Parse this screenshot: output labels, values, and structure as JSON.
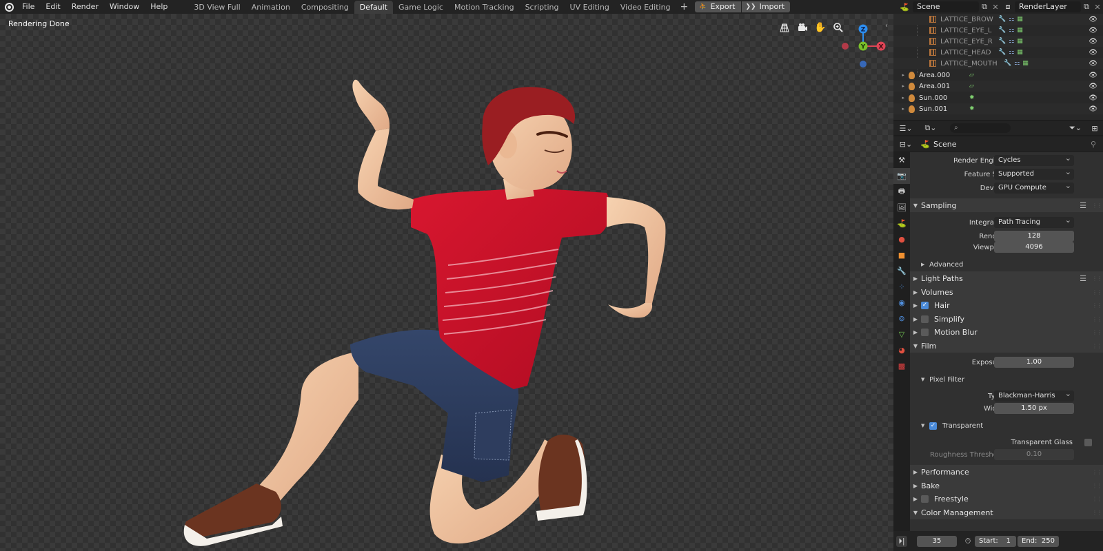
{
  "menu": [
    "File",
    "Edit",
    "Render",
    "Window",
    "Help"
  ],
  "workspaces": [
    "3D View Full",
    "Animation",
    "Compositing",
    "Default",
    "Game Logic",
    "Motion Tracking",
    "Scripting",
    "UV Editing",
    "Video Editing"
  ],
  "active_workspace": "Default",
  "add_workspace": "+",
  "io": {
    "export": "Export",
    "import": "Import"
  },
  "scene": {
    "scene_name": "Scene",
    "render_layer": "RenderLayer"
  },
  "viewport": {
    "status": "Rendering Done"
  },
  "gizmo": {
    "z": "Z",
    "y": "Y",
    "x": "X"
  },
  "outliner": {
    "items": [
      {
        "name": "LATTICE_BROW",
        "type": "lattice"
      },
      {
        "name": "LATTICE_EYE_L",
        "type": "lattice"
      },
      {
        "name": "LATTICE_EYE_R",
        "type": "lattice"
      },
      {
        "name": "LATTICE_HEAD",
        "type": "lattice"
      },
      {
        "name": "LATTICE_MOUTH",
        "type": "lattice"
      },
      {
        "name": "Area.000",
        "type": "light"
      },
      {
        "name": "Area.001",
        "type": "light"
      },
      {
        "name": "Sun.000",
        "type": "light"
      },
      {
        "name": "Sun.001",
        "type": "light"
      }
    ]
  },
  "properties": {
    "context": "Scene",
    "search_placeholder": "",
    "render_engine": {
      "label": "Render Engine",
      "value": "Cycles"
    },
    "feature_set": {
      "label": "Feature Set",
      "value": "Supported"
    },
    "device": {
      "label": "Device",
      "value": "GPU Compute"
    },
    "sampling": {
      "title": "Sampling",
      "integrator": {
        "label": "Integrator",
        "value": "Path Tracing"
      },
      "render": {
        "label": "Render",
        "value": "128"
      },
      "viewport": {
        "label": "Viewport",
        "value": "4096"
      },
      "advanced": "Advanced"
    },
    "light_paths": "Light Paths",
    "volumes": "Volumes",
    "hair": {
      "label": "Hair",
      "checked": true
    },
    "simplify": {
      "label": "Simplify",
      "checked": false
    },
    "motion_blur": {
      "label": "Motion Blur",
      "checked": false
    },
    "film": {
      "title": "Film",
      "exposure": {
        "label": "Exposure",
        "value": "1.00"
      },
      "pixel_filter": "Pixel Filter",
      "type": {
        "label": "Type",
        "value": "Blackman-Harris"
      },
      "width": {
        "label": "Width",
        "value": "1.50 px"
      },
      "transparent": {
        "label": "Transparent",
        "checked": true
      },
      "transparent_glass": {
        "label": "Transparent Glass",
        "checked": false
      },
      "roughness_threshold": {
        "label": "Roughness Threshold",
        "value": "0.10"
      }
    },
    "performance": "Performance",
    "bake": "Bake",
    "freestyle": {
      "label": "Freestyle",
      "checked": false
    },
    "color_management": "Color Management"
  },
  "timeline": {
    "current_frame": "35",
    "start_label": "Start:",
    "start": "1",
    "end_label": "End:",
    "end": "250"
  },
  "colors": {
    "accent_blue": "#4a8ad8",
    "axis_x": "#e04455",
    "axis_y": "#7ac02a",
    "axis_z": "#2c8ef0",
    "shirt": "#c8102e",
    "shorts": "#2c3a56"
  }
}
